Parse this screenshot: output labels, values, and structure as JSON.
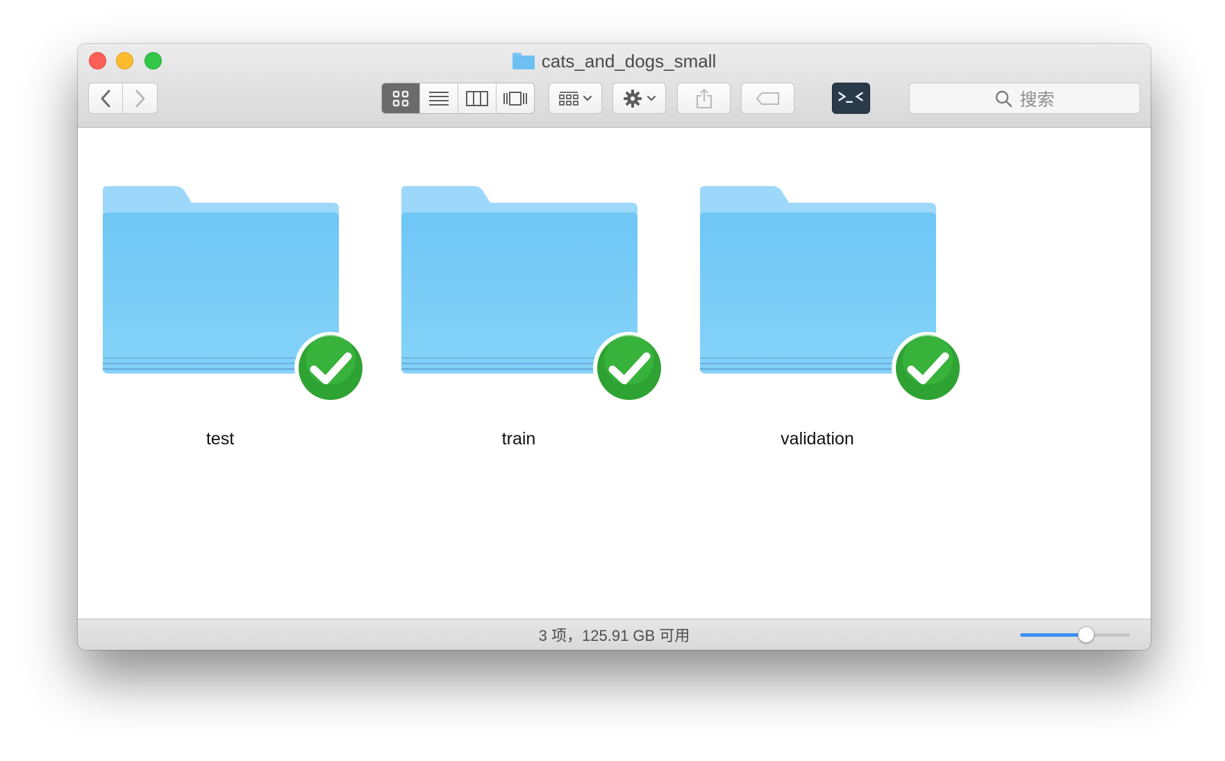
{
  "window": {
    "title": "cats_and_dogs_small"
  },
  "toolbar": {
    "search_placeholder": "搜索",
    "view_modes": [
      "icon",
      "list",
      "column",
      "cover-flow"
    ],
    "active_view": "icon"
  },
  "items": [
    {
      "name": "test",
      "sync_status": "synced"
    },
    {
      "name": "train",
      "sync_status": "synced"
    },
    {
      "name": "validation",
      "sync_status": "synced"
    }
  ],
  "status_bar": {
    "text": "3 项，125.91 GB 可用",
    "icon_size_level": 0.6
  },
  "colors": {
    "folder": "#6ec6f5",
    "badge": "#2ea232",
    "slider_fill": "#3b8ff4"
  }
}
